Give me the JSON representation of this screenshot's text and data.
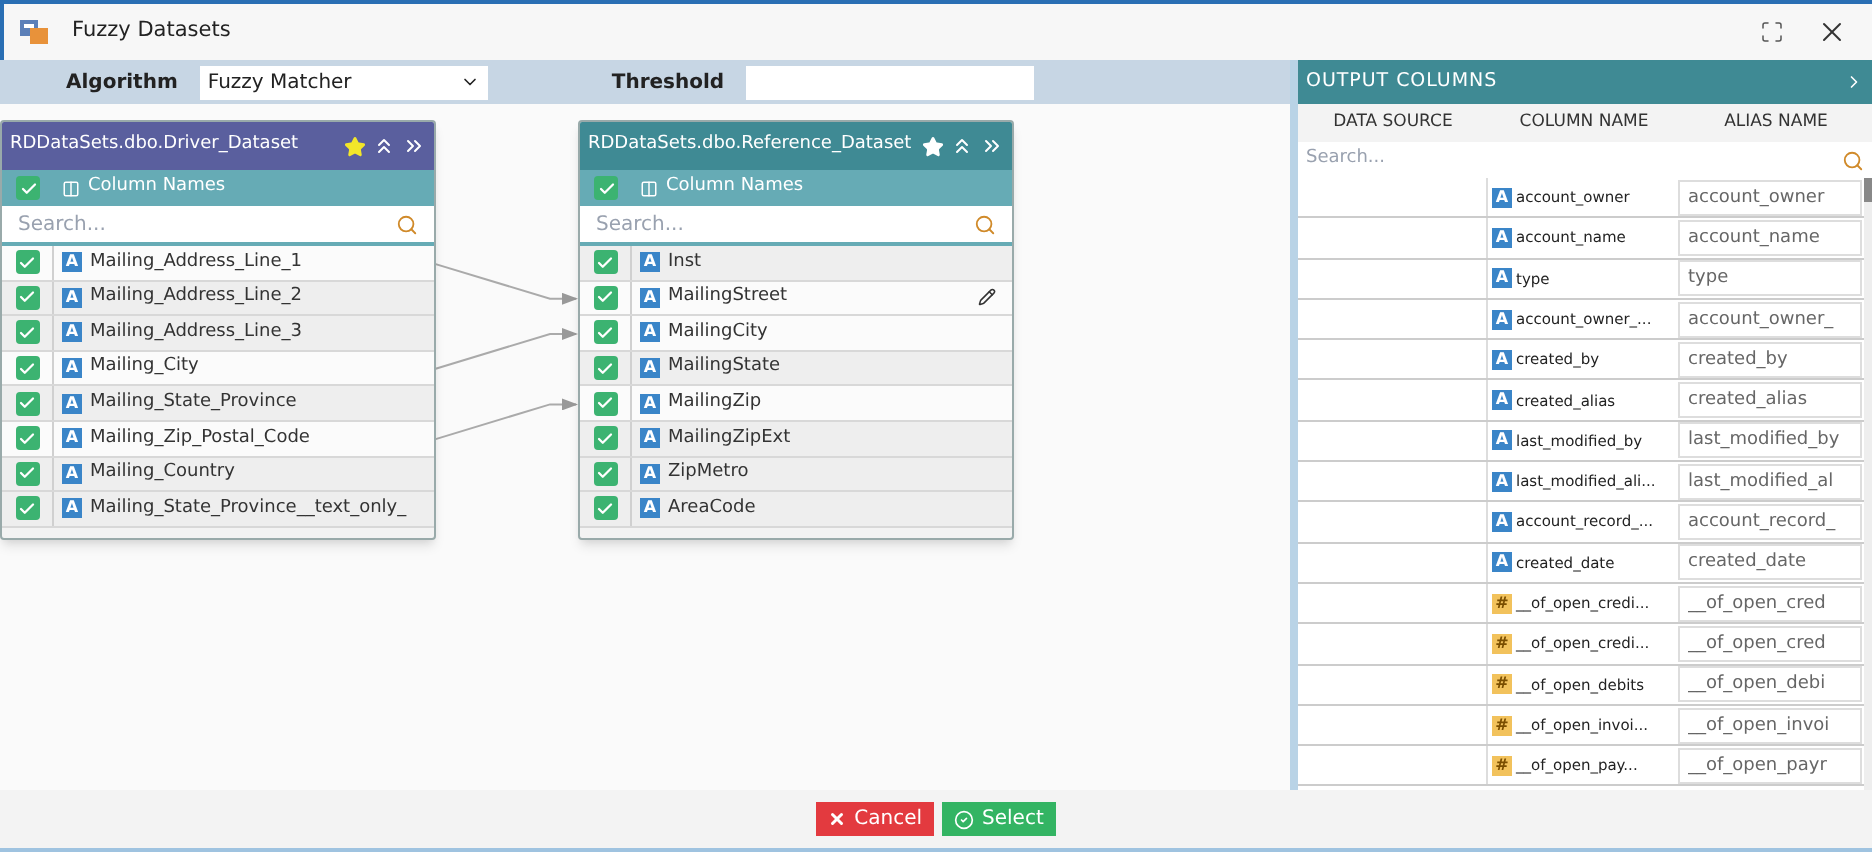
{
  "window": {
    "title": "Fuzzy Datasets"
  },
  "toolbar": {
    "algorithm_label": "Algorithm",
    "algorithm_value": "Fuzzy Matcher",
    "threshold_label": "Threshold"
  },
  "driver_card": {
    "title": "RDDataSets.dbo.Driver_Dataset",
    "starred": true,
    "header_label": "Column Names",
    "all_checked": true,
    "search_placeholder": "Search...",
    "rows": [
      {
        "kind": "text",
        "type_icon": "A",
        "name": "Mailing_Address_Line_1",
        "checked": true,
        "linked": true
      },
      {
        "kind": "text",
        "type_icon": "A",
        "name": "Mailing_Address_Line_2",
        "checked": true,
        "linked": false
      },
      {
        "kind": "text",
        "type_icon": "A",
        "name": "Mailing_Address_Line_3",
        "checked": true,
        "linked": false
      },
      {
        "kind": "text",
        "type_icon": "A",
        "name": "Mailing_City",
        "checked": true,
        "linked": true
      },
      {
        "kind": "text",
        "type_icon": "A",
        "name": "Mailing_State_Province",
        "checked": true,
        "linked": false
      },
      {
        "kind": "text",
        "type_icon": "A",
        "name": "Mailing_Zip_Postal_Code",
        "checked": true,
        "linked": true
      },
      {
        "kind": "text",
        "type_icon": "A",
        "name": "Mailing_Country",
        "checked": true,
        "linked": false
      },
      {
        "kind": "text",
        "type_icon": "A",
        "name": "Mailing_State_Province__text_only_",
        "checked": true,
        "linked": false
      }
    ]
  },
  "reference_card": {
    "title": "RDDataSets.dbo.Reference_Dataset",
    "starred": false,
    "header_label": "Column Names",
    "all_checked": true,
    "search_placeholder": "Search...",
    "rows": [
      {
        "kind": "text",
        "type_icon": "A",
        "name": "Inst",
        "checked": true,
        "linked": false
      },
      {
        "kind": "text",
        "type_icon": "A",
        "name": "MailingStreet",
        "checked": true,
        "linked": true,
        "editable": true
      },
      {
        "kind": "text",
        "type_icon": "A",
        "name": "MailingCity",
        "checked": true,
        "linked": true
      },
      {
        "kind": "text",
        "type_icon": "A",
        "name": "MailingState",
        "checked": true,
        "linked": false
      },
      {
        "kind": "text",
        "type_icon": "A",
        "name": "MailingZip",
        "checked": true,
        "linked": true
      },
      {
        "kind": "text",
        "type_icon": "A",
        "name": "MailingZipExt",
        "checked": true,
        "linked": false
      },
      {
        "kind": "text",
        "type_icon": "A",
        "name": "ZipMetro",
        "checked": true,
        "linked": false
      },
      {
        "kind": "text",
        "type_icon": "A",
        "name": "AreaCode",
        "checked": true,
        "linked": false
      }
    ]
  },
  "output_panel": {
    "title": "OUTPUT COLUMNS",
    "columns": [
      "DATA SOURCE",
      "COLUMN NAME",
      "ALIAS NAME"
    ],
    "search_placeholder": "Search...",
    "rows": [
      {
        "kind": "text",
        "type_icon": "A",
        "column": "account_owner",
        "alias": "account_owner"
      },
      {
        "kind": "text",
        "type_icon": "A",
        "column": "account_name",
        "alias": "account_name"
      },
      {
        "kind": "text",
        "type_icon": "A",
        "column": "type",
        "alias": "type"
      },
      {
        "kind": "text",
        "type_icon": "A",
        "column": "account_owner_...",
        "alias": "account_owner_"
      },
      {
        "kind": "text",
        "type_icon": "A",
        "column": "created_by",
        "alias": "created_by"
      },
      {
        "kind": "text",
        "type_icon": "A",
        "column": "created_alias",
        "alias": "created_alias"
      },
      {
        "kind": "text",
        "type_icon": "A",
        "column": "last_modified_by",
        "alias": "last_modified_by"
      },
      {
        "kind": "text",
        "type_icon": "A",
        "column": "last_modified_ali...",
        "alias": "last_modified_al"
      },
      {
        "kind": "text",
        "type_icon": "A",
        "column": "account_record_...",
        "alias": "account_record_"
      },
      {
        "kind": "text",
        "type_icon": "A",
        "column": "created_date",
        "alias": "created_date"
      },
      {
        "kind": "number",
        "type_icon": "#",
        "column": "__of_open_credi...",
        "alias": "__of_open_cred"
      },
      {
        "kind": "number",
        "type_icon": "#",
        "column": "__of_open_credi...",
        "alias": "__of_open_cred"
      },
      {
        "kind": "number",
        "type_icon": "#",
        "column": "__of_open_debits",
        "alias": "__of_open_debi"
      },
      {
        "kind": "number",
        "type_icon": "#",
        "column": "__of_open_invoi...",
        "alias": "__of_open_invoi"
      },
      {
        "kind": "number",
        "type_icon": "#",
        "column": "__of_open_pay...",
        "alias": "__of_open_payr"
      }
    ]
  },
  "buttons": [
    {
      "kind": "cancel",
      "label": "Cancel"
    },
    {
      "kind": "select",
      "label": "Select"
    }
  ]
}
